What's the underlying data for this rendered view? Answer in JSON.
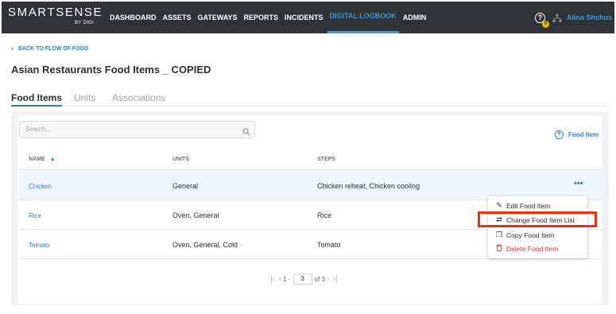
{
  "app": {
    "logo_main": "SMARTSENSE",
    "logo_sub": "BY DIGI",
    "nav": [
      "DASHBOARD",
      "ASSETS",
      "GATEWAYS",
      "REPORTS",
      "INCIDENTS",
      "DIGITAL LOGBOOK",
      "ADMIN"
    ],
    "active_nav": "DIGITAL LOGBOOK",
    "help_badge": "0",
    "user_name": "Alina Shchus",
    "accent_color": "#3a9ad9"
  },
  "header": {
    "back_link": "BACK TO FLOW OF FOOD",
    "title": "Asian Restaurants Food Items _ COPIED",
    "tabs": [
      "Food Items",
      "Units",
      "Associations"
    ],
    "active_tab": "Food Items"
  },
  "toolbar": {
    "search_placeholder": "Search...",
    "add_button": "Food Item"
  },
  "table": {
    "columns": [
      "NAME",
      "UNITS",
      "STEPS"
    ],
    "rows": [
      {
        "name": "Chicken",
        "units": "General",
        "steps": "Chicken reheat, Chicken cooling"
      },
      {
        "name": "Rice",
        "units": "Oven, General",
        "steps": "Rice"
      },
      {
        "name": "Tomato",
        "units": "Oven, General, Cold",
        "steps": "Tomato"
      }
    ]
  },
  "context_menu": {
    "items": [
      "Edit Food Item",
      "Change Food Item List",
      "Copy Food Item",
      "Delete Food Item"
    ],
    "highlighted": "Change Food Item List",
    "danger_color": "#d93030"
  },
  "pagination": {
    "first_part": "1 -",
    "current": "3",
    "total": "of 3"
  }
}
